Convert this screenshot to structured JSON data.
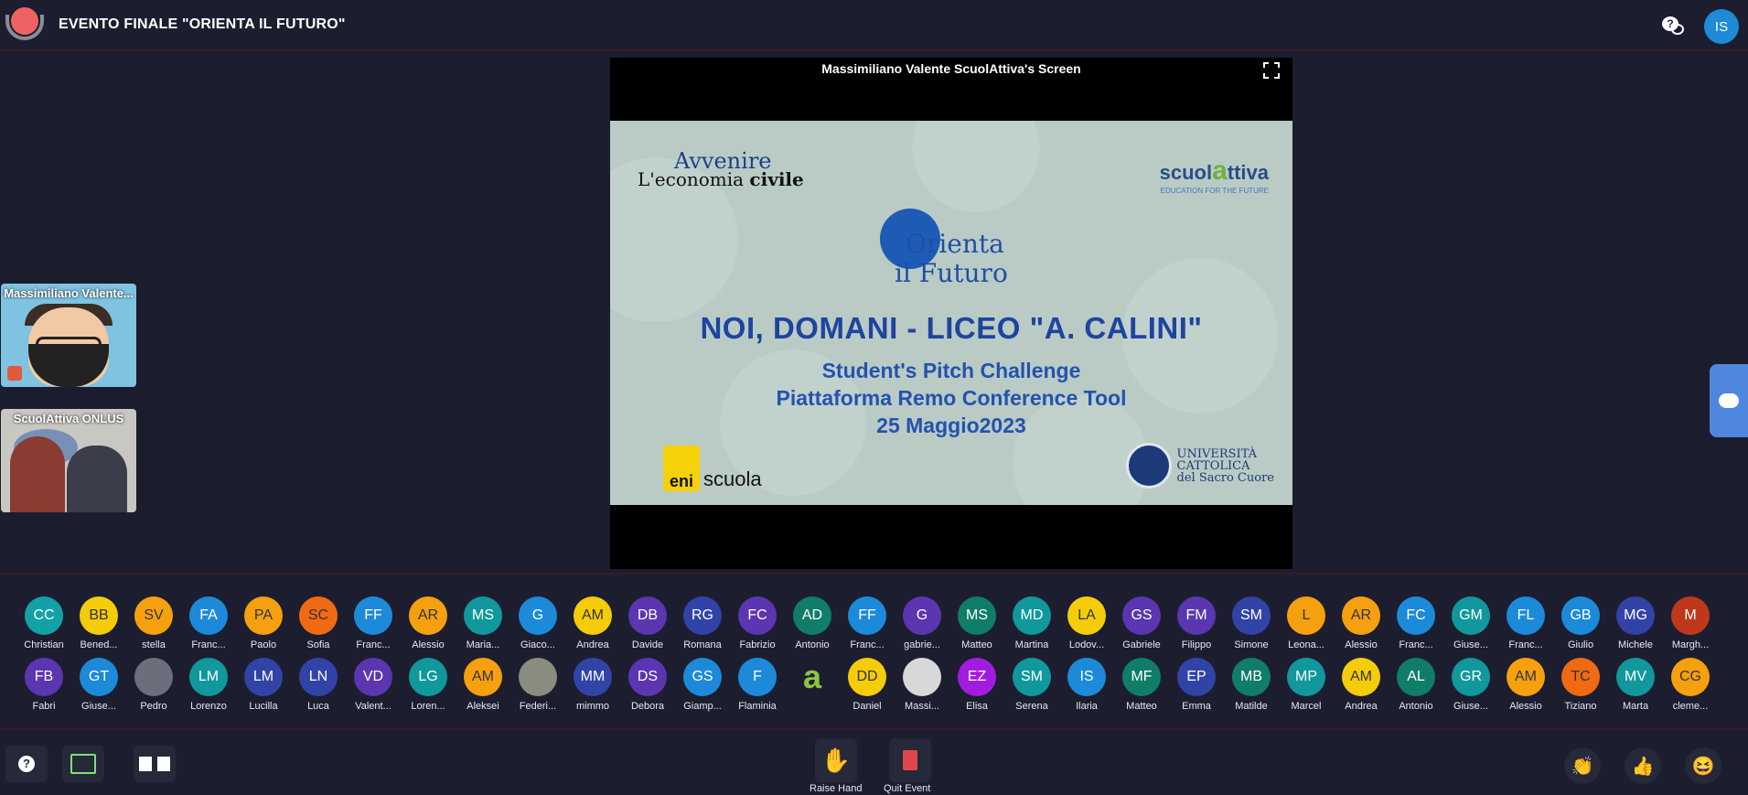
{
  "header": {
    "event_title": "EVENTO FINALE \"ORIENTA IL FUTURO\"",
    "user_initials": "IS"
  },
  "screen_share": {
    "title": "Massimiliano Valente ScuolAttiva's Screen",
    "slide": {
      "logo_avvenire": "Avvenire",
      "logo_econ_1": "L'economia ",
      "logo_econ_2": "civile",
      "logo_scuol_1": "scuol",
      "logo_scuol_2": "a",
      "logo_scuol_3": "ttiva",
      "logo_scuol_tag": "EDUCATION FOR THE FUTURE",
      "orienta_1": "Orienta",
      "orienta_2": "il Futuro",
      "headline": "NOI, DOMANI - LICEO \"A. CALINI\"",
      "line1": "Student's Pitch Challenge",
      "line2": "Piattaforma Remo Conference Tool",
      "line3": "25 Maggio2023",
      "eni_box": "eni",
      "eni_text": "scuola",
      "catt_1": "UNIVERSITÀ",
      "catt_2": "CATTOLICA",
      "catt_3": "del Sacro Cuore"
    }
  },
  "tiles": [
    {
      "label": "Massimiliano Valente..."
    },
    {
      "label": "ScuolAttiva ONLUS"
    }
  ],
  "participants_row1": [
    {
      "initials": "CC",
      "name": "Christian",
      "color": "#13a1a8"
    },
    {
      "initials": "BB",
      "name": "Bened...",
      "color": "#f5cc0a",
      "dark": true
    },
    {
      "initials": "SV",
      "name": "stella",
      "color": "#f5a00f",
      "dark": true
    },
    {
      "initials": "FA",
      "name": "Franc...",
      "color": "#1c8ad8"
    },
    {
      "initials": "PA",
      "name": "Paolo",
      "color": "#f5a00f",
      "dark": true
    },
    {
      "initials": "SC",
      "name": "Sofia",
      "color": "#f06a14",
      "dark": true
    },
    {
      "initials": "FF",
      "name": "Franc...",
      "color": "#1c8ad8"
    },
    {
      "initials": "AR",
      "name": "Alessio",
      "color": "#f5a00f",
      "dark": true
    },
    {
      "initials": "MS",
      "name": "Maria...",
      "color": "#10989c"
    },
    {
      "initials": "G",
      "name": "Giaco...",
      "color": "#1c8ad8"
    },
    {
      "initials": "AM",
      "name": "Andrea",
      "color": "#f5cc0a",
      "dark": true
    },
    {
      "initials": "DB",
      "name": "Davide",
      "color": "#5b36b0"
    },
    {
      "initials": "RG",
      "name": "Romana",
      "color": "#3243a8"
    },
    {
      "initials": "FC",
      "name": "Fabrizio",
      "color": "#5b36b0"
    },
    {
      "initials": "AD",
      "name": "Antonio",
      "color": "#0f7d68"
    },
    {
      "initials": "FF",
      "name": "Franc...",
      "color": "#1c8ad8"
    },
    {
      "initials": "G",
      "name": "gabrie...",
      "color": "#5b36b0"
    },
    {
      "initials": "MS",
      "name": "Matteo",
      "color": "#0f7d68"
    },
    {
      "initials": "MD",
      "name": "Martina",
      "color": "#10989c"
    },
    {
      "initials": "LA",
      "name": "Lodov...",
      "color": "#f5cc0a",
      "dark": true
    },
    {
      "initials": "GS",
      "name": "Gabriele",
      "color": "#5b36b0"
    },
    {
      "initials": "FM",
      "name": "Filippo",
      "color": "#5b36b0"
    },
    {
      "initials": "SM",
      "name": "Simone",
      "color": "#3243a8"
    },
    {
      "initials": "L",
      "name": "Leona...",
      "color": "#f5a00f",
      "dark": true
    },
    {
      "initials": "AR",
      "name": "Alessio",
      "color": "#f5a00f",
      "dark": true
    },
    {
      "initials": "FC",
      "name": "Franc...",
      "color": "#1c8ad8"
    },
    {
      "initials": "GM",
      "name": "Giuse...",
      "color": "#10989c"
    },
    {
      "initials": "FL",
      "name": "Franc...",
      "color": "#1c8ad8"
    },
    {
      "initials": "GB",
      "name": "Giulio",
      "color": "#1c8ad8"
    },
    {
      "initials": "MG",
      "name": "Michele",
      "color": "#3243a8"
    },
    {
      "initials": "M",
      "name": "Margh...",
      "color": "#c0381c"
    }
  ],
  "participants_row2": [
    {
      "initials": "FB",
      "name": "Fabri",
      "color": "#5b36b0"
    },
    {
      "initials": "GT",
      "name": "Giuse...",
      "color": "#1c8ad8"
    },
    {
      "initials": "",
      "name": "Pedro",
      "color": "#6b6f7c"
    },
    {
      "initials": "LM",
      "name": "Lorenzo",
      "color": "#10989c"
    },
    {
      "initials": "LM",
      "name": "Lucilla",
      "color": "#3243a8"
    },
    {
      "initials": "LN",
      "name": "Luca",
      "color": "#3243a8"
    },
    {
      "initials": "VD",
      "name": "Valent...",
      "color": "#5b36b0"
    },
    {
      "initials": "LG",
      "name": "Loren...",
      "color": "#10989c"
    },
    {
      "initials": "AM",
      "name": "Aleksei",
      "color": "#f5a00f",
      "dark": true
    },
    {
      "initials": "",
      "name": "Federi...",
      "color": "#8a8c80"
    },
    {
      "initials": "MM",
      "name": "mimmo",
      "color": "#3243a8"
    },
    {
      "initials": "DS",
      "name": "Debora",
      "color": "#5b36b0"
    },
    {
      "initials": "GS",
      "name": "Giamp...",
      "color": "#1c8ad8"
    },
    {
      "initials": "F",
      "name": "Flaminia",
      "color": "#1c8ad8"
    },
    {
      "initials": "a",
      "name": "",
      "color": "#1c1e30",
      "green": true
    },
    {
      "initials": "DD",
      "name": "Daniel",
      "color": "#f5cc0a",
      "dark": true
    },
    {
      "initials": "",
      "name": "Massi...",
      "color": "#d8d8d8"
    },
    {
      "initials": "EZ",
      "name": "Elisa",
      "color": "#a21ce0"
    },
    {
      "initials": "SM",
      "name": "Serena",
      "color": "#10989c"
    },
    {
      "initials": "IS",
      "name": "Ilaria",
      "color": "#1c8ad8"
    },
    {
      "initials": "MF",
      "name": "Matteo",
      "color": "#0f7d68"
    },
    {
      "initials": "EP",
      "name": "Emma",
      "color": "#3243a8"
    },
    {
      "initials": "MB",
      "name": "Matilde",
      "color": "#0f7d68"
    },
    {
      "initials": "MP",
      "name": "Marcel",
      "color": "#10989c"
    },
    {
      "initials": "AM",
      "name": "Andrea",
      "color": "#f5cc0a",
      "dark": true
    },
    {
      "initials": "AL",
      "name": "Antonio",
      "color": "#0f7d68"
    },
    {
      "initials": "GR",
      "name": "Giuse...",
      "color": "#10989c"
    },
    {
      "initials": "AM",
      "name": "Alessio",
      "color": "#f5a00f",
      "dark": true
    },
    {
      "initials": "TC",
      "name": "Tiziano",
      "color": "#f06a14",
      "dark": true
    },
    {
      "initials": "MV",
      "name": "Marta",
      "color": "#10989c"
    },
    {
      "initials": "CG",
      "name": "cleme...",
      "color": "#f5a00f",
      "dark": true
    }
  ],
  "bottom": {
    "raise_hand": "Raise Hand",
    "quit_event": "Quit Event"
  }
}
